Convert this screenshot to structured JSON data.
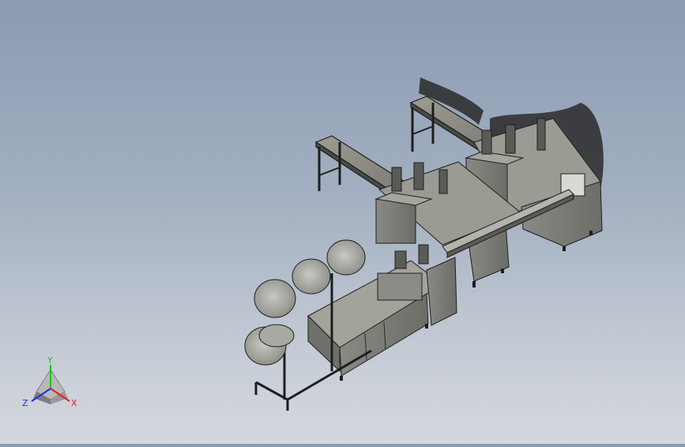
{
  "view": {
    "background_top": "#8a9bb1",
    "background_bottom": "#d4d7de"
  },
  "triad": {
    "x_label": "X",
    "y_label": "Y",
    "z_label": "Z",
    "x_color": "#e02020",
    "y_color": "#20c020",
    "z_color": "#2030e0"
  }
}
